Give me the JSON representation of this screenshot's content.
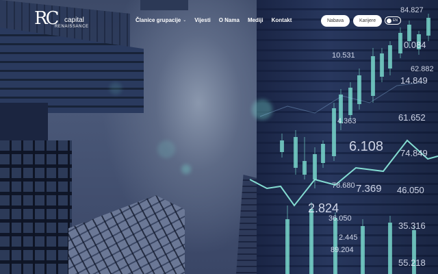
{
  "brand": {
    "logo_mark": "RC",
    "logo_word": "capital",
    "logo_sub": "RENAISSANCE"
  },
  "nav": {
    "items": [
      {
        "label": "Članice grupacije",
        "has_dropdown": true
      },
      {
        "label": "Vijesti"
      },
      {
        "label": "O Nama"
      },
      {
        "label": "Mediji"
      },
      {
        "label": "Kontakt"
      }
    ],
    "buttons": {
      "procurement": "Nabava",
      "careers": "Karijere"
    },
    "language": "EN",
    "dropdown_icon": "chevron-down-icon"
  },
  "hero": {
    "ticker_numbers": [
      "84.827",
      "0.084",
      "62.882",
      "10.531",
      "14.849",
      "4.363",
      "61.652",
      "6.108",
      "74.849",
      "78.680",
      "7.369",
      "46.050",
      "2.824",
      "36.050",
      "35.316",
      "2.445",
      "89.204",
      "55.218"
    ],
    "colors": {
      "candle": "#7fe3d4",
      "background": "#3d4a68"
    }
  }
}
